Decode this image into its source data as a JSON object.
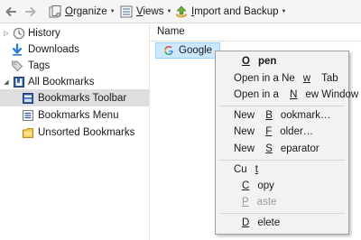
{
  "toolbar": {
    "back_icon": "back-arrow-icon",
    "forward_icon": "forward-arrow-icon",
    "organize": {
      "pre": "",
      "mnemonic": "O",
      "post": "rganize",
      "icon": "organize-icon"
    },
    "views": {
      "pre": "",
      "mnemonic": "V",
      "post": "iews",
      "icon": "views-icon"
    },
    "import_backup": {
      "pre": "",
      "mnemonic": "I",
      "post": "mport and Backup",
      "icon": "import-backup-icon"
    }
  },
  "sidebar": {
    "items": [
      {
        "label": "History",
        "icon": "history-clock-icon",
        "expandable": true,
        "expanded": false
      },
      {
        "label": "Downloads",
        "icon": "download-arrow-icon",
        "expandable": false
      },
      {
        "label": "Tags",
        "icon": "tag-icon",
        "expandable": false
      },
      {
        "label": "All Bookmarks",
        "icon": "bookmarks-folder-icon",
        "expandable": true,
        "expanded": true
      },
      {
        "label": "Bookmarks Toolbar",
        "icon": "bookmarks-toolbar-icon",
        "selected": true
      },
      {
        "label": "Bookmarks Menu",
        "icon": "bookmarks-menu-icon"
      },
      {
        "label": "Unsorted Bookmarks",
        "icon": "unsorted-bookmarks-icon"
      }
    ]
  },
  "content": {
    "column_header": "Name",
    "rows": [
      {
        "label": "Google",
        "icon": "google-favicon-icon",
        "selected": true
      }
    ]
  },
  "context_menu": {
    "items": [
      {
        "pre": "",
        "mnemonic": "O",
        "post": "pen",
        "bold": true
      },
      {
        "pre": "Open in a Ne",
        "mnemonic": "w",
        "post": " Tab"
      },
      {
        "pre": "Open in a ",
        "mnemonic": "N",
        "post": "ew Window"
      },
      {
        "separator": true
      },
      {
        "pre": "New ",
        "mnemonic": "B",
        "post": "ookmark…"
      },
      {
        "pre": "New ",
        "mnemonic": "F",
        "post": "older…"
      },
      {
        "pre": "New ",
        "mnemonic": "S",
        "post": "eparator"
      },
      {
        "separator": true
      },
      {
        "pre": "Cu",
        "mnemonic": "t",
        "post": ""
      },
      {
        "pre": "",
        "mnemonic": "C",
        "post": "opy"
      },
      {
        "pre": "",
        "mnemonic": "P",
        "post": "aste",
        "disabled": true
      },
      {
        "separator": true
      },
      {
        "pre": "",
        "mnemonic": "D",
        "post": "elete"
      }
    ]
  },
  "colors": {
    "selection_bg": "#cce8ff",
    "selection_border": "#99d1ff",
    "tree_selected_bg": "#dedede",
    "menu_bg": "#f2f2f2",
    "disabled_text": "#9a9a9a"
  }
}
